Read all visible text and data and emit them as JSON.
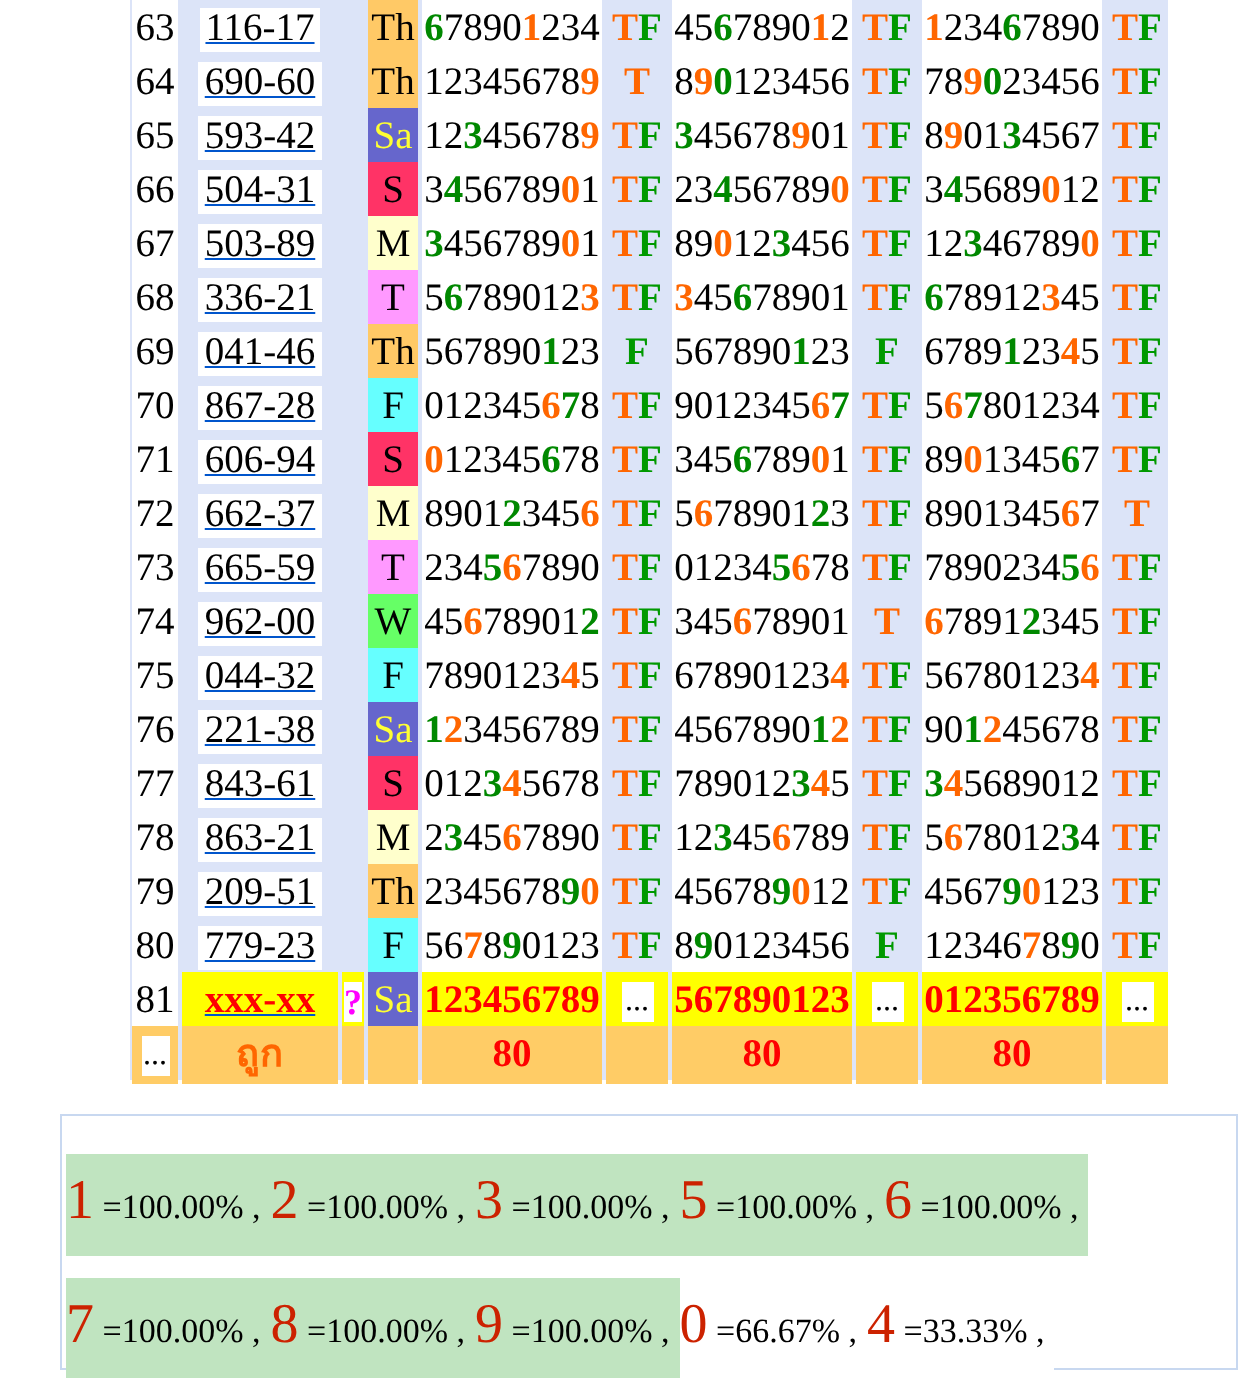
{
  "rows": [
    {
      "kind": "result",
      "num": "63",
      "code": "116-17",
      "day": {
        "label": "Th",
        "color": "#ffc966"
      },
      "groups": [
        {
          "digits": [
            {
              "text": "6",
              "color": "#008800"
            },
            {
              "text": "7890",
              "color": "#000000"
            },
            {
              "text": "1",
              "color": "#ff6600"
            },
            {
              "text": "234",
              "color": "#000000"
            }
          ],
          "mark": [
            {
              "text": "T",
              "color": "#ff6600"
            },
            {
              "text": "F",
              "color": "#009900"
            }
          ]
        },
        {
          "digits": [
            {
              "text": "45",
              "color": "#000000"
            },
            {
              "text": "6",
              "color": "#008800"
            },
            {
              "text": "7890",
              "color": "#000000"
            },
            {
              "text": "1",
              "color": "#ff6600"
            },
            {
              "text": "2",
              "color": "#000000"
            }
          ],
          "mark": [
            {
              "text": "T",
              "color": "#ff6600"
            },
            {
              "text": "F",
              "color": "#009900"
            }
          ]
        },
        {
          "digits": [
            {
              "text": "1",
              "color": "#ff6600"
            },
            {
              "text": "234",
              "color": "#000000"
            },
            {
              "text": "6",
              "color": "#008800"
            },
            {
              "text": "7890",
              "color": "#000000"
            }
          ],
          "mark": [
            {
              "text": "T",
              "color": "#ff6600"
            },
            {
              "text": "F",
              "color": "#009900"
            }
          ]
        }
      ]
    },
    {
      "kind": "result",
      "num": "64",
      "code": "690-60",
      "day": {
        "label": "Th",
        "color": "#ffc966"
      },
      "groups": [
        {
          "digits": [
            {
              "text": "12345678",
              "color": "#000000"
            },
            {
              "text": "9",
              "color": "#ff6600"
            }
          ],
          "mark": [
            {
              "text": "T",
              "color": "#ff6600"
            }
          ]
        },
        {
          "digits": [
            {
              "text": "8",
              "color": "#000000"
            },
            {
              "text": "9",
              "color": "#ff6600"
            },
            {
              "text": "0",
              "color": "#008800"
            },
            {
              "text": "123456",
              "color": "#000000"
            }
          ],
          "mark": [
            {
              "text": "T",
              "color": "#ff6600"
            },
            {
              "text": "F",
              "color": "#009900"
            }
          ]
        },
        {
          "digits": [
            {
              "text": "78",
              "color": "#000000"
            },
            {
              "text": "9",
              "color": "#ff6600"
            },
            {
              "text": "0",
              "color": "#008800"
            },
            {
              "text": "23456",
              "color": "#000000"
            }
          ],
          "mark": [
            {
              "text": "T",
              "color": "#ff6600"
            },
            {
              "text": "F",
              "color": "#009900"
            }
          ]
        }
      ]
    },
    {
      "kind": "result",
      "num": "65",
      "code": "593-42",
      "day": {
        "label": "Sa",
        "color": "#6666cc"
      },
      "groups": [
        {
          "digits": [
            {
              "text": "12",
              "color": "#000000"
            },
            {
              "text": "3",
              "color": "#008800"
            },
            {
              "text": "45678",
              "color": "#000000"
            },
            {
              "text": "9",
              "color": "#ff6600"
            }
          ],
          "mark": [
            {
              "text": "T",
              "color": "#ff6600"
            },
            {
              "text": "F",
              "color": "#009900"
            }
          ]
        },
        {
          "digits": [
            {
              "text": "3",
              "color": "#008800"
            },
            {
              "text": "45678",
              "color": "#000000"
            },
            {
              "text": "9",
              "color": "#ff6600"
            },
            {
              "text": "01",
              "color": "#000000"
            }
          ],
          "mark": [
            {
              "text": "T",
              "color": "#ff6600"
            },
            {
              "text": "F",
              "color": "#009900"
            }
          ]
        },
        {
          "digits": [
            {
              "text": "8",
              "color": "#000000"
            },
            {
              "text": "9",
              "color": "#ff6600"
            },
            {
              "text": "01",
              "color": "#000000"
            },
            {
              "text": "3",
              "color": "#008800"
            },
            {
              "text": "4567",
              "color": "#000000"
            }
          ],
          "mark": [
            {
              "text": "T",
              "color": "#ff6600"
            },
            {
              "text": "F",
              "color": "#009900"
            }
          ]
        }
      ]
    },
    {
      "kind": "result",
      "num": "66",
      "code": "504-31",
      "day": {
        "label": "S",
        "color": "#ff3366"
      },
      "groups": [
        {
          "digits": [
            {
              "text": "3",
              "color": "#000000"
            },
            {
              "text": "4",
              "color": "#008800"
            },
            {
              "text": "56789",
              "color": "#000000"
            },
            {
              "text": "0",
              "color": "#ff6600"
            },
            {
              "text": "1",
              "color": "#000000"
            }
          ],
          "mark": [
            {
              "text": "T",
              "color": "#ff6600"
            },
            {
              "text": "F",
              "color": "#009900"
            }
          ]
        },
        {
          "digits": [
            {
              "text": "23",
              "color": "#000000"
            },
            {
              "text": "4",
              "color": "#008800"
            },
            {
              "text": "56789",
              "color": "#000000"
            },
            {
              "text": "0",
              "color": "#ff6600"
            }
          ],
          "mark": [
            {
              "text": "T",
              "color": "#ff6600"
            },
            {
              "text": "F",
              "color": "#009900"
            }
          ]
        },
        {
          "digits": [
            {
              "text": "3",
              "color": "#000000"
            },
            {
              "text": "4",
              "color": "#008800"
            },
            {
              "text": "5689",
              "color": "#000000"
            },
            {
              "text": "0",
              "color": "#ff6600"
            },
            {
              "text": "12",
              "color": "#000000"
            }
          ],
          "mark": [
            {
              "text": "T",
              "color": "#ff6600"
            },
            {
              "text": "F",
              "color": "#009900"
            }
          ]
        }
      ]
    },
    {
      "kind": "result",
      "num": "67",
      "code": "503-89",
      "day": {
        "label": "M",
        "color": "#ffffcc"
      },
      "groups": [
        {
          "digits": [
            {
              "text": "3",
              "color": "#008800"
            },
            {
              "text": "456789",
              "color": "#000000"
            },
            {
              "text": "0",
              "color": "#ff6600"
            },
            {
              "text": "1",
              "color": "#000000"
            }
          ],
          "mark": [
            {
              "text": "T",
              "color": "#ff6600"
            },
            {
              "text": "F",
              "color": "#009900"
            }
          ]
        },
        {
          "digits": [
            {
              "text": "89",
              "color": "#000000"
            },
            {
              "text": "0",
              "color": "#ff6600"
            },
            {
              "text": "12",
              "color": "#000000"
            },
            {
              "text": "3",
              "color": "#008800"
            },
            {
              "text": "456",
              "color": "#000000"
            }
          ],
          "mark": [
            {
              "text": "T",
              "color": "#ff6600"
            },
            {
              "text": "F",
              "color": "#009900"
            }
          ]
        },
        {
          "digits": [
            {
              "text": "12",
              "color": "#000000"
            },
            {
              "text": "3",
              "color": "#008800"
            },
            {
              "text": "46789",
              "color": "#000000"
            },
            {
              "text": "0",
              "color": "#ff6600"
            }
          ],
          "mark": [
            {
              "text": "T",
              "color": "#ff6600"
            },
            {
              "text": "F",
              "color": "#009900"
            }
          ]
        }
      ]
    },
    {
      "kind": "result",
      "num": "68",
      "code": "336-21",
      "day": {
        "label": "T",
        "color": "#ff99ff"
      },
      "groups": [
        {
          "digits": [
            {
              "text": "5",
              "color": "#000000"
            },
            {
              "text": "6",
              "color": "#008800"
            },
            {
              "text": "789012",
              "color": "#000000"
            },
            {
              "text": "3",
              "color": "#ff6600"
            }
          ],
          "mark": [
            {
              "text": "T",
              "color": "#ff6600"
            },
            {
              "text": "F",
              "color": "#009900"
            }
          ]
        },
        {
          "digits": [
            {
              "text": "3",
              "color": "#ff6600"
            },
            {
              "text": "45",
              "color": "#000000"
            },
            {
              "text": "6",
              "color": "#008800"
            },
            {
              "text": "78901",
              "color": "#000000"
            }
          ],
          "mark": [
            {
              "text": "T",
              "color": "#ff6600"
            },
            {
              "text": "F",
              "color": "#009900"
            }
          ]
        },
        {
          "digits": [
            {
              "text": "6",
              "color": "#008800"
            },
            {
              "text": "78912",
              "color": "#000000"
            },
            {
              "text": "3",
              "color": "#ff6600"
            },
            {
              "text": "45",
              "color": "#000000"
            }
          ],
          "mark": [
            {
              "text": "T",
              "color": "#ff6600"
            },
            {
              "text": "F",
              "color": "#009900"
            }
          ]
        }
      ]
    },
    {
      "kind": "result",
      "num": "69",
      "code": "041-46",
      "day": {
        "label": "Th",
        "color": "#ffc966"
      },
      "groups": [
        {
          "digits": [
            {
              "text": "567890",
              "color": "#000000"
            },
            {
              "text": "1",
              "color": "#008800"
            },
            {
              "text": "23",
              "color": "#000000"
            }
          ],
          "mark": [
            {
              "text": "F",
              "color": "#009900"
            }
          ]
        },
        {
          "digits": [
            {
              "text": "567890",
              "color": "#000000"
            },
            {
              "text": "1",
              "color": "#008800"
            },
            {
              "text": "23",
              "color": "#000000"
            }
          ],
          "mark": [
            {
              "text": "F",
              "color": "#009900"
            }
          ]
        },
        {
          "digits": [
            {
              "text": "6789",
              "color": "#000000"
            },
            {
              "text": "1",
              "color": "#008800"
            },
            {
              "text": "23",
              "color": "#000000"
            },
            {
              "text": "4",
              "color": "#ff6600"
            },
            {
              "text": "5",
              "color": "#000000"
            }
          ],
          "mark": [
            {
              "text": "T",
              "color": "#ff6600"
            },
            {
              "text": "F",
              "color": "#009900"
            }
          ]
        }
      ]
    },
    {
      "kind": "result",
      "num": "70",
      "code": "867-28",
      "day": {
        "label": "F",
        "color": "#66ffff"
      },
      "groups": [
        {
          "digits": [
            {
              "text": "012345",
              "color": "#000000"
            },
            {
              "text": "6",
              "color": "#ff6600"
            },
            {
              "text": "7",
              "color": "#008800"
            },
            {
              "text": "8",
              "color": "#000000"
            }
          ],
          "mark": [
            {
              "text": "T",
              "color": "#ff6600"
            },
            {
              "text": "F",
              "color": "#009900"
            }
          ]
        },
        {
          "digits": [
            {
              "text": "9012345",
              "color": "#000000"
            },
            {
              "text": "6",
              "color": "#ff6600"
            },
            {
              "text": "7",
              "color": "#008800"
            }
          ],
          "mark": [
            {
              "text": "T",
              "color": "#ff6600"
            },
            {
              "text": "F",
              "color": "#009900"
            }
          ]
        },
        {
          "digits": [
            {
              "text": "5",
              "color": "#000000"
            },
            {
              "text": "6",
              "color": "#ff6600"
            },
            {
              "text": "7",
              "color": "#008800"
            },
            {
              "text": "801234",
              "color": "#000000"
            }
          ],
          "mark": [
            {
              "text": "T",
              "color": "#ff6600"
            },
            {
              "text": "F",
              "color": "#009900"
            }
          ]
        }
      ]
    },
    {
      "kind": "result",
      "num": "71",
      "code": "606-94",
      "day": {
        "label": "S",
        "color": "#ff3366"
      },
      "groups": [
        {
          "digits": [
            {
              "text": "0",
              "color": "#ff6600"
            },
            {
              "text": "12345",
              "color": "#000000"
            },
            {
              "text": "6",
              "color": "#008800"
            },
            {
              "text": "78",
              "color": "#000000"
            }
          ],
          "mark": [
            {
              "text": "T",
              "color": "#ff6600"
            },
            {
              "text": "F",
              "color": "#009900"
            }
          ]
        },
        {
          "digits": [
            {
              "text": "345",
              "color": "#000000"
            },
            {
              "text": "6",
              "color": "#008800"
            },
            {
              "text": "789",
              "color": "#000000"
            },
            {
              "text": "0",
              "color": "#ff6600"
            },
            {
              "text": "1",
              "color": "#000000"
            }
          ],
          "mark": [
            {
              "text": "T",
              "color": "#ff6600"
            },
            {
              "text": "F",
              "color": "#009900"
            }
          ]
        },
        {
          "digits": [
            {
              "text": "89",
              "color": "#000000"
            },
            {
              "text": "0",
              "color": "#ff6600"
            },
            {
              "text": "1345",
              "color": "#000000"
            },
            {
              "text": "6",
              "color": "#008800"
            },
            {
              "text": "7",
              "color": "#000000"
            }
          ],
          "mark": [
            {
              "text": "T",
              "color": "#ff6600"
            },
            {
              "text": "F",
              "color": "#009900"
            }
          ]
        }
      ]
    },
    {
      "kind": "result",
      "num": "72",
      "code": "662-37",
      "day": {
        "label": "M",
        "color": "#ffffcc"
      },
      "groups": [
        {
          "digits": [
            {
              "text": "8901",
              "color": "#000000"
            },
            {
              "text": "2",
              "color": "#008800"
            },
            {
              "text": "345",
              "color": "#000000"
            },
            {
              "text": "6",
              "color": "#ff6600"
            }
          ],
          "mark": [
            {
              "text": "T",
              "color": "#ff6600"
            },
            {
              "text": "F",
              "color": "#009900"
            }
          ]
        },
        {
          "digits": [
            {
              "text": "5",
              "color": "#000000"
            },
            {
              "text": "6",
              "color": "#ff6600"
            },
            {
              "text": "78901",
              "color": "#000000"
            },
            {
              "text": "2",
              "color": "#008800"
            },
            {
              "text": "3",
              "color": "#000000"
            }
          ],
          "mark": [
            {
              "text": "T",
              "color": "#ff6600"
            },
            {
              "text": "F",
              "color": "#009900"
            }
          ]
        },
        {
          "digits": [
            {
              "text": "8901345",
              "color": "#000000"
            },
            {
              "text": "6",
              "color": "#ff6600"
            },
            {
              "text": "7",
              "color": "#000000"
            }
          ],
          "mark": [
            {
              "text": "T",
              "color": "#ff6600"
            }
          ]
        }
      ]
    },
    {
      "kind": "result",
      "num": "73",
      "code": "665-59",
      "day": {
        "label": "T",
        "color": "#ff99ff"
      },
      "groups": [
        {
          "digits": [
            {
              "text": "234",
              "color": "#000000"
            },
            {
              "text": "5",
              "color": "#008800"
            },
            {
              "text": "6",
              "color": "#ff6600"
            },
            {
              "text": "7890",
              "color": "#000000"
            }
          ],
          "mark": [
            {
              "text": "T",
              "color": "#ff6600"
            },
            {
              "text": "F",
              "color": "#009900"
            }
          ]
        },
        {
          "digits": [
            {
              "text": "01234",
              "color": "#000000"
            },
            {
              "text": "5",
              "color": "#008800"
            },
            {
              "text": "6",
              "color": "#ff6600"
            },
            {
              "text": "78",
              "color": "#000000"
            }
          ],
          "mark": [
            {
              "text": "T",
              "color": "#ff6600"
            },
            {
              "text": "F",
              "color": "#009900"
            }
          ]
        },
        {
          "digits": [
            {
              "text": "7890234",
              "color": "#000000"
            },
            {
              "text": "5",
              "color": "#008800"
            },
            {
              "text": "6",
              "color": "#ff6600"
            }
          ],
          "mark": [
            {
              "text": "T",
              "color": "#ff6600"
            },
            {
              "text": "F",
              "color": "#009900"
            }
          ]
        }
      ]
    },
    {
      "kind": "result",
      "num": "74",
      "code": "962-00",
      "day": {
        "label": "W",
        "color": "#66ff66"
      },
      "groups": [
        {
          "digits": [
            {
              "text": "45",
              "color": "#000000"
            },
            {
              "text": "6",
              "color": "#ff6600"
            },
            {
              "text": "78901",
              "color": "#000000"
            },
            {
              "text": "2",
              "color": "#008800"
            }
          ],
          "mark": [
            {
              "text": "T",
              "color": "#ff6600"
            },
            {
              "text": "F",
              "color": "#009900"
            }
          ]
        },
        {
          "digits": [
            {
              "text": "345",
              "color": "#000000"
            },
            {
              "text": "6",
              "color": "#ff6600"
            },
            {
              "text": "78901",
              "color": "#000000"
            }
          ],
          "mark": [
            {
              "text": "T",
              "color": "#ff6600"
            }
          ]
        },
        {
          "digits": [
            {
              "text": "6",
              "color": "#ff6600"
            },
            {
              "text": "7891",
              "color": "#000000"
            },
            {
              "text": "2",
              "color": "#008800"
            },
            {
              "text": "345",
              "color": "#000000"
            }
          ],
          "mark": [
            {
              "text": "T",
              "color": "#ff6600"
            },
            {
              "text": "F",
              "color": "#009900"
            }
          ]
        }
      ]
    },
    {
      "kind": "result",
      "num": "75",
      "code": "044-32",
      "day": {
        "label": "F",
        "color": "#66ffff"
      },
      "groups": [
        {
          "digits": [
            {
              "text": "7890123",
              "color": "#000000"
            },
            {
              "text": "4",
              "color": "#ff6600"
            },
            {
              "text": "5",
              "color": "#000000"
            }
          ],
          "mark": [
            {
              "text": "T",
              "color": "#ff6600"
            },
            {
              "text": "F",
              "color": "#009900"
            }
          ]
        },
        {
          "digits": [
            {
              "text": "67890123",
              "color": "#000000"
            },
            {
              "text": "4",
              "color": "#ff6600"
            }
          ],
          "mark": [
            {
              "text": "T",
              "color": "#ff6600"
            },
            {
              "text": "F",
              "color": "#009900"
            }
          ]
        },
        {
          "digits": [
            {
              "text": "56780123",
              "color": "#000000"
            },
            {
              "text": "4",
              "color": "#ff6600"
            }
          ],
          "mark": [
            {
              "text": "T",
              "color": "#ff6600"
            },
            {
              "text": "F",
              "color": "#009900"
            }
          ]
        }
      ]
    },
    {
      "kind": "result",
      "num": "76",
      "code": "221-38",
      "day": {
        "label": "Sa",
        "color": "#6666cc"
      },
      "groups": [
        {
          "digits": [
            {
              "text": "1",
              "color": "#008800"
            },
            {
              "text": "2",
              "color": "#ff6600"
            },
            {
              "text": "3456789",
              "color": "#000000"
            }
          ],
          "mark": [
            {
              "text": "T",
              "color": "#ff6600"
            },
            {
              "text": "F",
              "color": "#009900"
            }
          ]
        },
        {
          "digits": [
            {
              "text": "4567890",
              "color": "#000000"
            },
            {
              "text": "1",
              "color": "#008800"
            },
            {
              "text": "2",
              "color": "#ff6600"
            }
          ],
          "mark": [
            {
              "text": "T",
              "color": "#ff6600"
            },
            {
              "text": "F",
              "color": "#009900"
            }
          ]
        },
        {
          "digits": [
            {
              "text": "90",
              "color": "#000000"
            },
            {
              "text": "1",
              "color": "#008800"
            },
            {
              "text": "2",
              "color": "#ff6600"
            },
            {
              "text": "45678",
              "color": "#000000"
            }
          ],
          "mark": [
            {
              "text": "T",
              "color": "#ff6600"
            },
            {
              "text": "F",
              "color": "#009900"
            }
          ]
        }
      ]
    },
    {
      "kind": "result",
      "num": "77",
      "code": "843-61",
      "day": {
        "label": "S",
        "color": "#ff3366"
      },
      "groups": [
        {
          "digits": [
            {
              "text": "012",
              "color": "#000000"
            },
            {
              "text": "3",
              "color": "#008800"
            },
            {
              "text": "4",
              "color": "#ff6600"
            },
            {
              "text": "5678",
              "color": "#000000"
            }
          ],
          "mark": [
            {
              "text": "T",
              "color": "#ff6600"
            },
            {
              "text": "F",
              "color": "#009900"
            }
          ]
        },
        {
          "digits": [
            {
              "text": "789012",
              "color": "#000000"
            },
            {
              "text": "3",
              "color": "#008800"
            },
            {
              "text": "4",
              "color": "#ff6600"
            },
            {
              "text": "5",
              "color": "#000000"
            }
          ],
          "mark": [
            {
              "text": "T",
              "color": "#ff6600"
            },
            {
              "text": "F",
              "color": "#009900"
            }
          ]
        },
        {
          "digits": [
            {
              "text": "3",
              "color": "#008800"
            },
            {
              "text": "4",
              "color": "#ff6600"
            },
            {
              "text": "5689012",
              "color": "#000000"
            }
          ],
          "mark": [
            {
              "text": "T",
              "color": "#ff6600"
            },
            {
              "text": "F",
              "color": "#009900"
            }
          ]
        }
      ]
    },
    {
      "kind": "result",
      "num": "78",
      "code": "863-21",
      "day": {
        "label": "M",
        "color": "#ffffcc"
      },
      "groups": [
        {
          "digits": [
            {
              "text": "2",
              "color": "#000000"
            },
            {
              "text": "3",
              "color": "#008800"
            },
            {
              "text": "45",
              "color": "#000000"
            },
            {
              "text": "6",
              "color": "#ff6600"
            },
            {
              "text": "7890",
              "color": "#000000"
            }
          ],
          "mark": [
            {
              "text": "T",
              "color": "#ff6600"
            },
            {
              "text": "F",
              "color": "#009900"
            }
          ]
        },
        {
          "digits": [
            {
              "text": "12",
              "color": "#000000"
            },
            {
              "text": "3",
              "color": "#008800"
            },
            {
              "text": "45",
              "color": "#000000"
            },
            {
              "text": "6",
              "color": "#ff6600"
            },
            {
              "text": "789",
              "color": "#000000"
            }
          ],
          "mark": [
            {
              "text": "T",
              "color": "#ff6600"
            },
            {
              "text": "F",
              "color": "#009900"
            }
          ]
        },
        {
          "digits": [
            {
              "text": "5",
              "color": "#000000"
            },
            {
              "text": "6",
              "color": "#ff6600"
            },
            {
              "text": "78012",
              "color": "#000000"
            },
            {
              "text": "3",
              "color": "#008800"
            },
            {
              "text": "4",
              "color": "#000000"
            }
          ],
          "mark": [
            {
              "text": "T",
              "color": "#ff6600"
            },
            {
              "text": "F",
              "color": "#009900"
            }
          ]
        }
      ]
    },
    {
      "kind": "result",
      "num": "79",
      "code": "209-51",
      "day": {
        "label": "Th",
        "color": "#ffc966"
      },
      "groups": [
        {
          "digits": [
            {
              "text": "2345678",
              "color": "#000000"
            },
            {
              "text": "9",
              "color": "#008800"
            },
            {
              "text": "0",
              "color": "#ff6600"
            }
          ],
          "mark": [
            {
              "text": "T",
              "color": "#ff6600"
            },
            {
              "text": "F",
              "color": "#009900"
            }
          ]
        },
        {
          "digits": [
            {
              "text": "45678",
              "color": "#000000"
            },
            {
              "text": "9",
              "color": "#008800"
            },
            {
              "text": "0",
              "color": "#ff6600"
            },
            {
              "text": "12",
              "color": "#000000"
            }
          ],
          "mark": [
            {
              "text": "T",
              "color": "#ff6600"
            },
            {
              "text": "F",
              "color": "#009900"
            }
          ]
        },
        {
          "digits": [
            {
              "text": "4567",
              "color": "#000000"
            },
            {
              "text": "9",
              "color": "#008800"
            },
            {
              "text": "0",
              "color": "#ff6600"
            },
            {
              "text": "123",
              "color": "#000000"
            }
          ],
          "mark": [
            {
              "text": "T",
              "color": "#ff6600"
            },
            {
              "text": "F",
              "color": "#009900"
            }
          ]
        }
      ]
    },
    {
      "kind": "result",
      "num": "80",
      "code": "779-23",
      "day": {
        "label": "F",
        "color": "#66ffff"
      },
      "groups": [
        {
          "digits": [
            {
              "text": "56",
              "color": "#000000"
            },
            {
              "text": "7",
              "color": "#ff6600"
            },
            {
              "text": "8",
              "color": "#000000"
            },
            {
              "text": "9",
              "color": "#008800"
            },
            {
              "text": "0123",
              "color": "#000000"
            }
          ],
          "mark": [
            {
              "text": "T",
              "color": "#ff6600"
            },
            {
              "text": "F",
              "color": "#009900"
            }
          ]
        },
        {
          "digits": [
            {
              "text": "8",
              "color": "#000000"
            },
            {
              "text": "9",
              "color": "#008800"
            },
            {
              "text": "0123456",
              "color": "#000000"
            }
          ],
          "mark": [
            {
              "text": "F",
              "color": "#009900"
            }
          ]
        },
        {
          "digits": [
            {
              "text": "12346",
              "color": "#000000"
            },
            {
              "text": "7",
              "color": "#ff6600"
            },
            {
              "text": "8",
              "color": "#000000"
            },
            {
              "text": "9",
              "color": "#008800"
            },
            {
              "text": "0",
              "color": "#000000"
            }
          ],
          "mark": [
            {
              "text": "T",
              "color": "#ff6600"
            },
            {
              "text": "F",
              "color": "#009900"
            }
          ]
        }
      ]
    },
    {
      "kind": "pending",
      "num": "81",
      "code": "xxx-xx",
      "flag": "?",
      "day": {
        "label": "Sa",
        "color": "#6666cc"
      },
      "groups": [
        {
          "digits": "123456789",
          "mark": "..."
        },
        {
          "digits": "567890123",
          "mark": "..."
        },
        {
          "digits": "012356789",
          "mark": "..."
        }
      ]
    }
  ],
  "footer": {
    "first": "...",
    "label": "ถูก",
    "totals": [
      "80",
      "80",
      "80"
    ]
  },
  "summary": [
    {
      "digit": "1",
      "text": "=100.00% ,",
      "hit": true
    },
    {
      "digit": "2",
      "text": "=100.00% ,",
      "hit": true
    },
    {
      "digit": "3",
      "text": "=100.00% ,",
      "hit": true
    },
    {
      "digit": "5",
      "text": "=100.00% ,",
      "hit": true
    },
    {
      "digit": "6",
      "text": "=100.00% ,",
      "hit": true
    },
    {
      "digit": "7",
      "text": "=100.00% ,",
      "hit": true
    },
    {
      "digit": "8",
      "text": "=100.00% ,",
      "hit": true
    },
    {
      "digit": "9",
      "text": "=100.00% ,",
      "hit": true
    },
    {
      "digit": "0",
      "text": "=66.67% ,",
      "hit": false
    },
    {
      "digit": "4",
      "text": "=33.33% ,",
      "hit": false
    }
  ]
}
